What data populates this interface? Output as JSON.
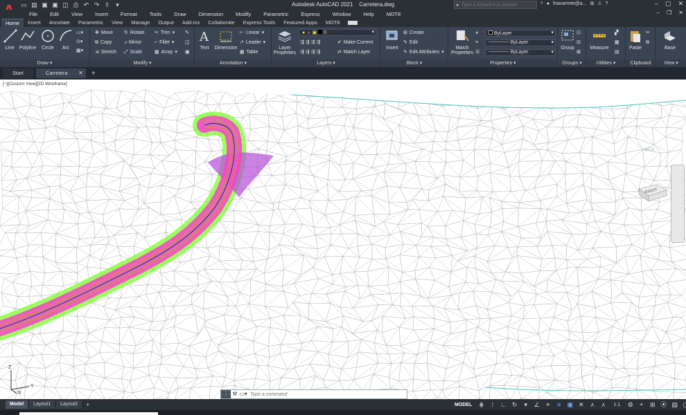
{
  "titlebar": {
    "app_name": "Autodesk AutoCAD 2021",
    "file_name": "Carretera.dwg",
    "search_placeholder": "Type a keyword or phrase",
    "user": "fnavarrete@a..."
  },
  "menu": [
    "File",
    "Edit",
    "View",
    "Insert",
    "Format",
    "Tools",
    "Draw",
    "Dimension",
    "Modify",
    "Parametric",
    "Express",
    "Window",
    "Help",
    "MDT8"
  ],
  "ribbon_tabs": [
    "Home",
    "Insert",
    "Annotate",
    "Parametric",
    "View",
    "Manage",
    "Output",
    "Add-ins",
    "Collaborate",
    "Express Tools",
    "Featured Apps",
    "MDT8"
  ],
  "ribbon": {
    "draw": {
      "title": "Draw",
      "line": "Line",
      "polyline": "Polyline",
      "circle": "Circle",
      "arc": "Arc"
    },
    "modify": {
      "title": "Modify",
      "move": "Move",
      "rotate": "Rotate",
      "trim": "Trim",
      "copy": "Copy",
      "mirror": "Mirror",
      "fillet": "Fillet",
      "stretch": "Stretch",
      "scale": "Scale",
      "array": "Array"
    },
    "annotation": {
      "title": "Annotation",
      "text": "Text",
      "dimension": "Dimension",
      "linear": "Linear",
      "leader": "Leader",
      "table": "Table"
    },
    "layers": {
      "title": "Layers",
      "layer_properties": "Layer Properties",
      "current_layer": "0",
      "make_current": "Make Current",
      "match_layer": "Match Layer"
    },
    "block": {
      "title": "Block",
      "insert": "Insert",
      "create": "Create",
      "edit": "Edit",
      "edit_attributes": "Edit Attributes"
    },
    "properties": {
      "title": "Properties",
      "match_properties": "Match Properties",
      "color": "ByLayer",
      "linetype": "ByLayer",
      "lineweight": "ByLayer"
    },
    "groups": {
      "title": "Groups",
      "group": "Group"
    },
    "utilities": {
      "title": "Utilities",
      "measure": "Measure"
    },
    "clipboard": {
      "title": "Clipboard",
      "paste": "Paste"
    },
    "view": {
      "title": "View",
      "base": "Base"
    }
  },
  "doc_tabs": {
    "start": "Start",
    "active": "Carretera"
  },
  "viewport_label": "[−][Custom View][2D Wireframe]",
  "viewcube": {
    "face": "RIGHT",
    "wcs": "WCS"
  },
  "ucs": {
    "z": "Z",
    "y": "Y",
    "x": "X"
  },
  "command_line": {
    "placeholder": "Type a command"
  },
  "layout_tabs": [
    "Model",
    "Layout1",
    "Layout2"
  ],
  "status": {
    "space": "MODEL",
    "scale": "1:1"
  },
  "colors": {
    "accent": "#e1353d",
    "ribbon_bg": "#3b4453",
    "road_fill": "#ff3cd2",
    "cut_fill": "#7aff2a"
  }
}
